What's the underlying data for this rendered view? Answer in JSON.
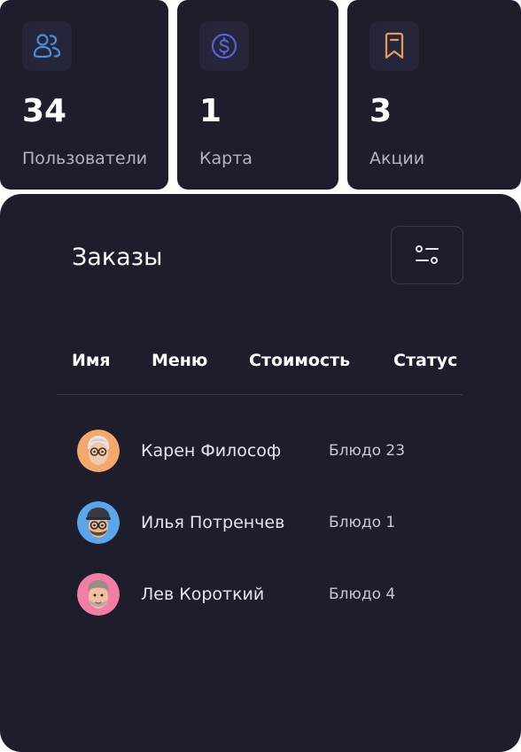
{
  "stats": [
    {
      "value": "34",
      "label": "Пользователи",
      "icon": "users-icon",
      "icon_color": "#4b8dd8"
    },
    {
      "value": "1",
      "label": "Карта",
      "icon": "dollar-coin-icon",
      "icon_color": "#5a5fcf"
    },
    {
      "value": "3",
      "label": "Акции",
      "icon": "bookmark-icon",
      "icon_color": "#e39a5a"
    }
  ],
  "orders": {
    "title": "Заказы",
    "filter_icon": "filter-settings-icon",
    "columns": [
      "Имя",
      "Меню",
      "Стоимость",
      "Статус"
    ],
    "rows": [
      {
        "name": "Карен Философ",
        "dish": "Блюдо 23",
        "avatar_bg": "#f5a86b"
      },
      {
        "name": "Илья Потренчев",
        "dish": "Блюдо 1",
        "avatar_bg": "#5aa6ea"
      },
      {
        "name": "Лев Короткий",
        "dish": "Блюдо 4",
        "avatar_bg": "#f27ea3"
      }
    ]
  },
  "colors": {
    "panel_bg": "#1e1d2c",
    "icon_box_bg": "#26263a",
    "muted_text": "#b4b3c3"
  }
}
